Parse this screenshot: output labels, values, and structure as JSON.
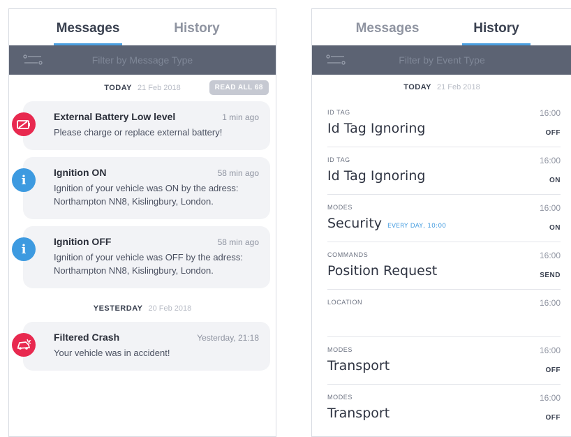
{
  "left": {
    "tabs": {
      "messages": "Messages",
      "history": "History"
    },
    "filter_label": "Filter by Message Type",
    "today": {
      "label": "TODAY",
      "date": "21 Feb 2018"
    },
    "read_all": "READ ALL 68",
    "messages": [
      {
        "title": "External Battery Low level",
        "time": "1 min ago",
        "body": "Please charge or replace external battery!",
        "icon": "battery-alert-icon"
      },
      {
        "title": "Ignition ON",
        "time": "58 min ago",
        "body": "Ignition of your vehicle was ON by the adress: Northampton NN8, Kislingbury, London.",
        "icon": "info-icon"
      },
      {
        "title": "Ignition OFF",
        "time": "58 min ago",
        "body": "Ignition of your vehicle was OFF by the adress: Northampton NN8, Kislingbury, London.",
        "icon": "info-icon"
      },
      {
        "title": "Filtered Crash",
        "time": "Yesterday, 21:18",
        "body": "Your vehicle was in accident!",
        "icon": "car-crash-icon"
      }
    ],
    "yesterday": {
      "label": "YESTERDAY",
      "date": "20 Feb 2018"
    }
  },
  "right": {
    "tabs": {
      "messages": "Messages",
      "history": "History"
    },
    "filter_label": "Filter by Event Type",
    "today": {
      "label": "TODAY",
      "date": "21 Feb 2018"
    },
    "events": [
      {
        "category": "ID TAG",
        "title": "Id Tag Ignoring",
        "time": "16:00",
        "status": "OFF",
        "schedule": ""
      },
      {
        "category": "ID TAG",
        "title": "Id Tag Ignoring",
        "time": "16:00",
        "status": "ON",
        "schedule": ""
      },
      {
        "category": "MODES",
        "title": "Security",
        "time": "16:00",
        "status": "ON",
        "schedule": "EVERY DAY, 10:00"
      },
      {
        "category": "COMMANDS",
        "title": "Position Request",
        "time": "16:00",
        "status": "SEND",
        "schedule": ""
      },
      {
        "category": "LOCATION",
        "title": "",
        "time": "16:00",
        "status": "",
        "schedule": ""
      },
      {
        "category": "MODES",
        "title": "Transport",
        "time": "16:00",
        "status": "OFF",
        "schedule": ""
      },
      {
        "category": "MODES",
        "title": "Transport",
        "time": "16:00",
        "status": "OFF",
        "schedule": ""
      }
    ]
  },
  "colors": {
    "accent": "#4a9fe0",
    "alert": "#e8294f",
    "info": "#3d9ae0",
    "filter_bar": "#5c6373"
  }
}
